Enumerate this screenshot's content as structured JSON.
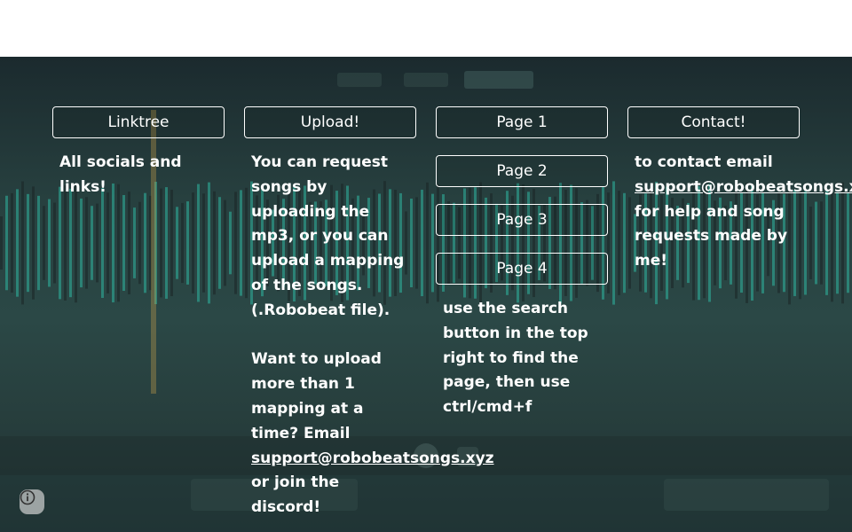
{
  "columns": [
    {
      "buttons": [
        "Linktree"
      ],
      "paragraphs": [
        "All socials and links!"
      ]
    },
    {
      "buttons": [
        "Upload!"
      ],
      "para1": "You can request songs by uploading the mp3, or you can upload a mapping of the songs. (.Robobeat file).",
      "para2_pre": "Want to upload more than 1 mapping at a time? Email ",
      "para2_link": "support@robobeatsongs.xyz",
      "para2_post": " or join the discord!"
    },
    {
      "buttons": [
        "Page 1",
        "Page 2",
        "Page 3",
        "Page 4"
      ],
      "paragraph": "use the search button in the top right to find the page, then use ctrl/cmd+f"
    },
    {
      "buttons": [
        "Contact!"
      ],
      "text_pre": "to contact email ",
      "link": "support@robobeatsongs.xyz",
      "text_post": " for help and song requests made by me!"
    }
  ],
  "icons": {
    "info": "info-icon"
  },
  "colors": {
    "accent_waveform": "#2fb5a0",
    "text": "#ffffff"
  }
}
